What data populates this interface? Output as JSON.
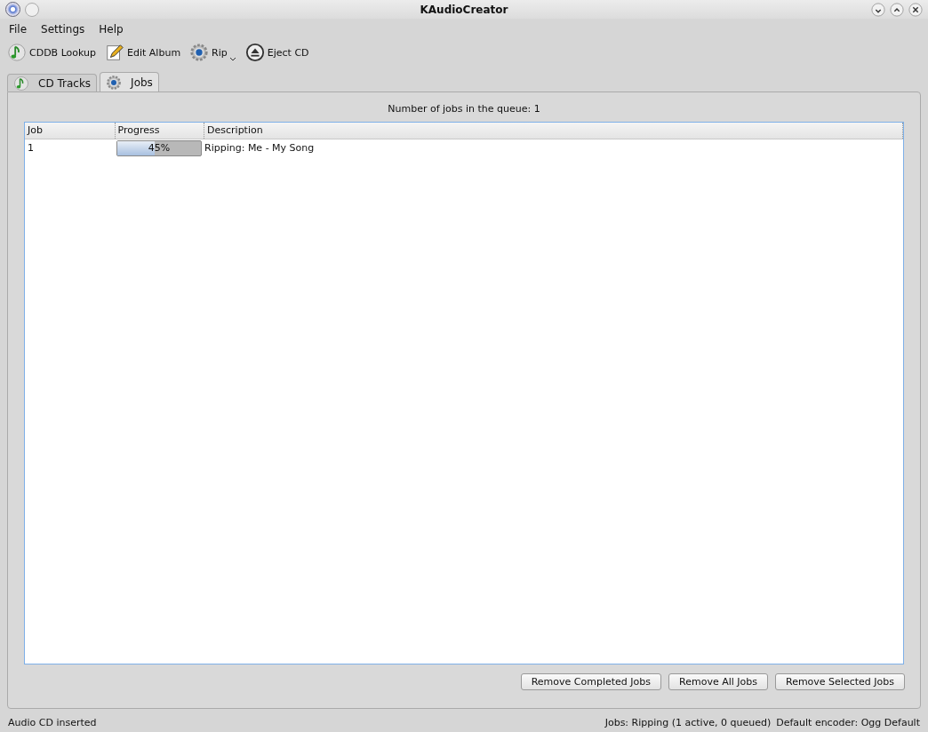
{
  "window": {
    "title": "KAudioCreator"
  },
  "menu": [
    "File",
    "Settings",
    "Help"
  ],
  "toolbar": [
    {
      "label": "CDDB Lookup",
      "kind": "note"
    },
    {
      "label": "Edit Album",
      "kind": "pencil"
    },
    {
      "label": "Rip",
      "kind": "gear",
      "dropdown": true
    },
    {
      "label": "Eject CD",
      "kind": "eject"
    }
  ],
  "tabs": [
    {
      "label": "CD Tracks",
      "kind": "note",
      "selected": false
    },
    {
      "label": "Jobs",
      "kind": "gear",
      "selected": true
    }
  ],
  "queue_label": "Number of jobs in the queue: 1",
  "table": {
    "columns": [
      "Job",
      "Progress",
      "Description"
    ],
    "rows": [
      {
        "job": "1",
        "level": 0.45,
        "progress": "45%",
        "description": "Ripping: Me - My Song"
      }
    ]
  },
  "buttons": [
    "Remove Completed Jobs",
    "Remove All Jobs",
    "Remove Selected Jobs"
  ],
  "status_bar": {
    "left": "Audio CD inserted",
    "jobs": "Jobs: Ripping (1 active, 0 queued)",
    "encoder": "Default encoder: Ogg Default"
  }
}
